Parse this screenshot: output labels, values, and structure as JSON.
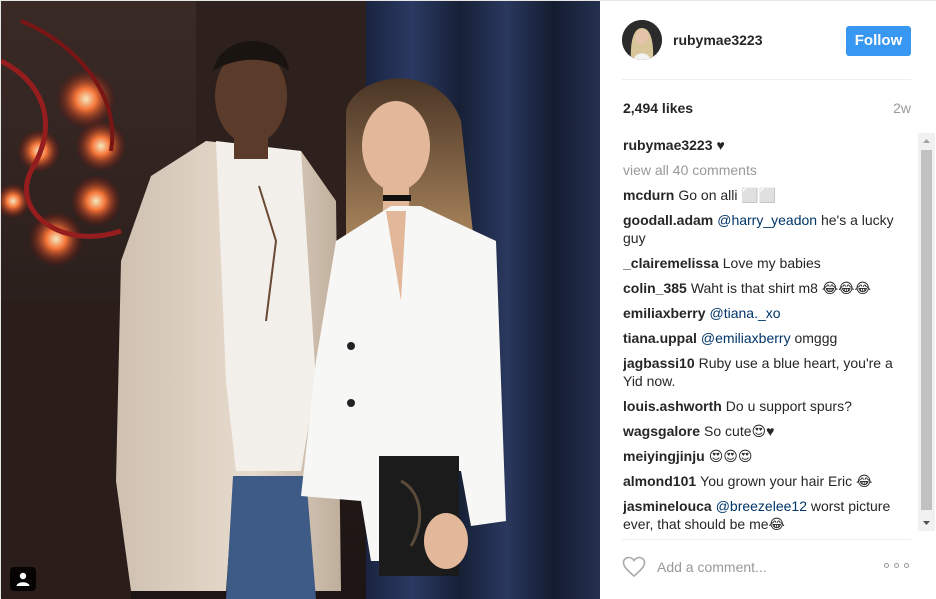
{
  "post": {
    "username": "rubymae3223",
    "follow_label": "Follow",
    "likes": "2,494 likes",
    "time_ago": "2w"
  },
  "caption": {
    "username": "rubymae3223",
    "text": "♥"
  },
  "view_all_comments": "view all 40 comments",
  "comments": [
    {
      "user": "mcdurn",
      "text": "Go on alli ⬜⬜"
    },
    {
      "user": "goodall.adam",
      "mention": "@harry_yeadon",
      "text": " he's a lucky guy"
    },
    {
      "user": "_clairemelissa",
      "text": "Love my babies"
    },
    {
      "user": "colin_385",
      "text": "Waht is that shirt m8 😂😂😂"
    },
    {
      "user": "emiliaxberry",
      "mention": "@tiana._xo",
      "text": ""
    },
    {
      "user": "tiana.uppal",
      "mention": "@emiliaxberry",
      "text": " omggg"
    },
    {
      "user": "jagbassi10",
      "text": "Ruby use a blue heart, you're a Yid now."
    },
    {
      "user": "louis.ashworth",
      "text": "Do u support spurs?"
    },
    {
      "user": "wagsgalore",
      "text": "So cute😍♥"
    },
    {
      "user": "meiyingjinju",
      "text": "😍😍😍"
    },
    {
      "user": "almond101",
      "text": "You grown your hair Eric 😂"
    },
    {
      "user": "jasminelouca",
      "mention": "@breezelee12",
      "text": " worst picture ever, that should be me😂"
    }
  ],
  "add_comment_placeholder": "Add a comment...",
  "icons": {
    "like": "heart-outline-icon",
    "more": "more-options-icon",
    "user_tag": "user-tag-icon"
  },
  "colors": {
    "follow_button": "#3897f0",
    "mention": "#003569",
    "muted": "#999999"
  }
}
